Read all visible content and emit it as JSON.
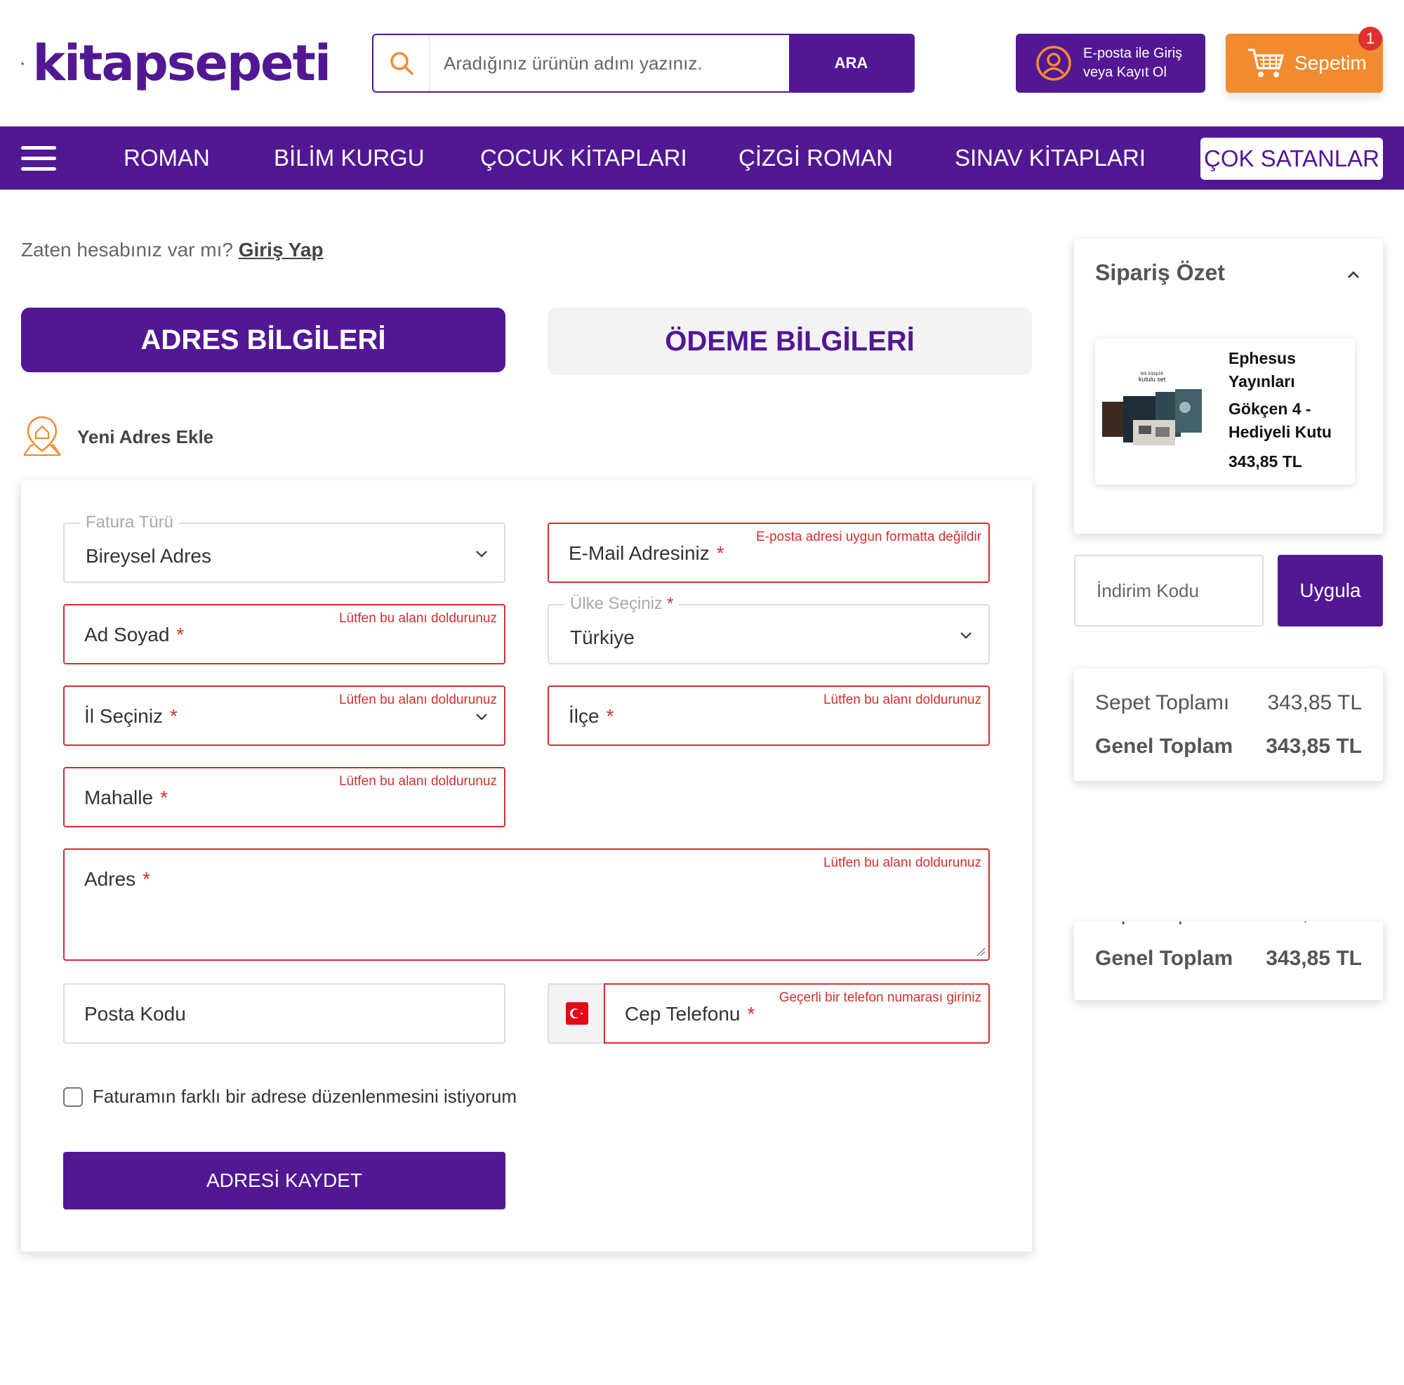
{
  "header": {
    "logo_text": "kitapsepeti",
    "search_placeholder": "Aradığınız ürünün adını yazınız.",
    "search_button": "ARA",
    "login_line1": "E-posta ile Giriş",
    "login_line2": "veya Kayıt Ol",
    "cart_label": "Sepetim",
    "cart_count": "1"
  },
  "nav": {
    "items": [
      "ROMAN",
      "BİLİM KURGU",
      "ÇOCUK KİTAPLARI",
      "ÇİZGİ ROMAN",
      "SINAV KİTAPLARI"
    ],
    "highlight": "ÇOK SATANLAR"
  },
  "checkout": {
    "have_account_text": "Zaten hesabınız var mı?",
    "login_link": "Giriş Yap",
    "tab_address": "ADRES BİLGİLERİ",
    "tab_payment": "ÖDEME BİLGİLERİ",
    "new_address": "Yeni Adres Ekle"
  },
  "form": {
    "invoice_type": {
      "label": "Fatura Türü",
      "value": "Bireysel Adres"
    },
    "email": {
      "label": "E-Mail Adresiniz",
      "error": "E-posta adresi uygun formatta değildir"
    },
    "name": {
      "label": "Ad Soyad",
      "error": "Lütfen bu alanı doldurunuz"
    },
    "country": {
      "label": "Ülke Seçiniz",
      "value": "Türkiye"
    },
    "city": {
      "label": "İl Seçiniz",
      "error": "Lütfen bu alanı doldurunuz"
    },
    "district": {
      "label": "İlçe",
      "error": "Lütfen bu alanı doldurunuz"
    },
    "neighborhood": {
      "label": "Mahalle",
      "error": "Lütfen bu alanı doldurunuz"
    },
    "address": {
      "label": "Adres",
      "error": "Lütfen bu alanı doldurunuz"
    },
    "postal_code": {
      "label": "Posta Kodu"
    },
    "phone": {
      "label": "Cep Telefonu",
      "error": "Geçerli bir telefon numarası giriniz"
    },
    "required_mark": "*",
    "different_invoice_label": "Faturamın farklı bir adrese düzenlenmesini istiyorum",
    "save_button": "ADRESİ KAYDET"
  },
  "summary": {
    "title": "Sipariş Özet",
    "product": {
      "publisher": "Ephesus Yayınları",
      "name": "Gökçen 4 - Hediyeli Kutu",
      "price": "343,85 TL",
      "thumb_caption1": "tek kitaplık",
      "thumb_caption2": "kutulu set"
    },
    "discount_placeholder": "İndirim Kodu",
    "discount_button": "Uygula",
    "subtotal_label": "Sepet Toplamı",
    "subtotal_value": "343,85 TL",
    "total_label": "Genel Toplam",
    "total_value": "343,85 TL"
  },
  "colors": {
    "primary": "#521893",
    "accent": "#f28b30",
    "error": "#d32f2f"
  }
}
